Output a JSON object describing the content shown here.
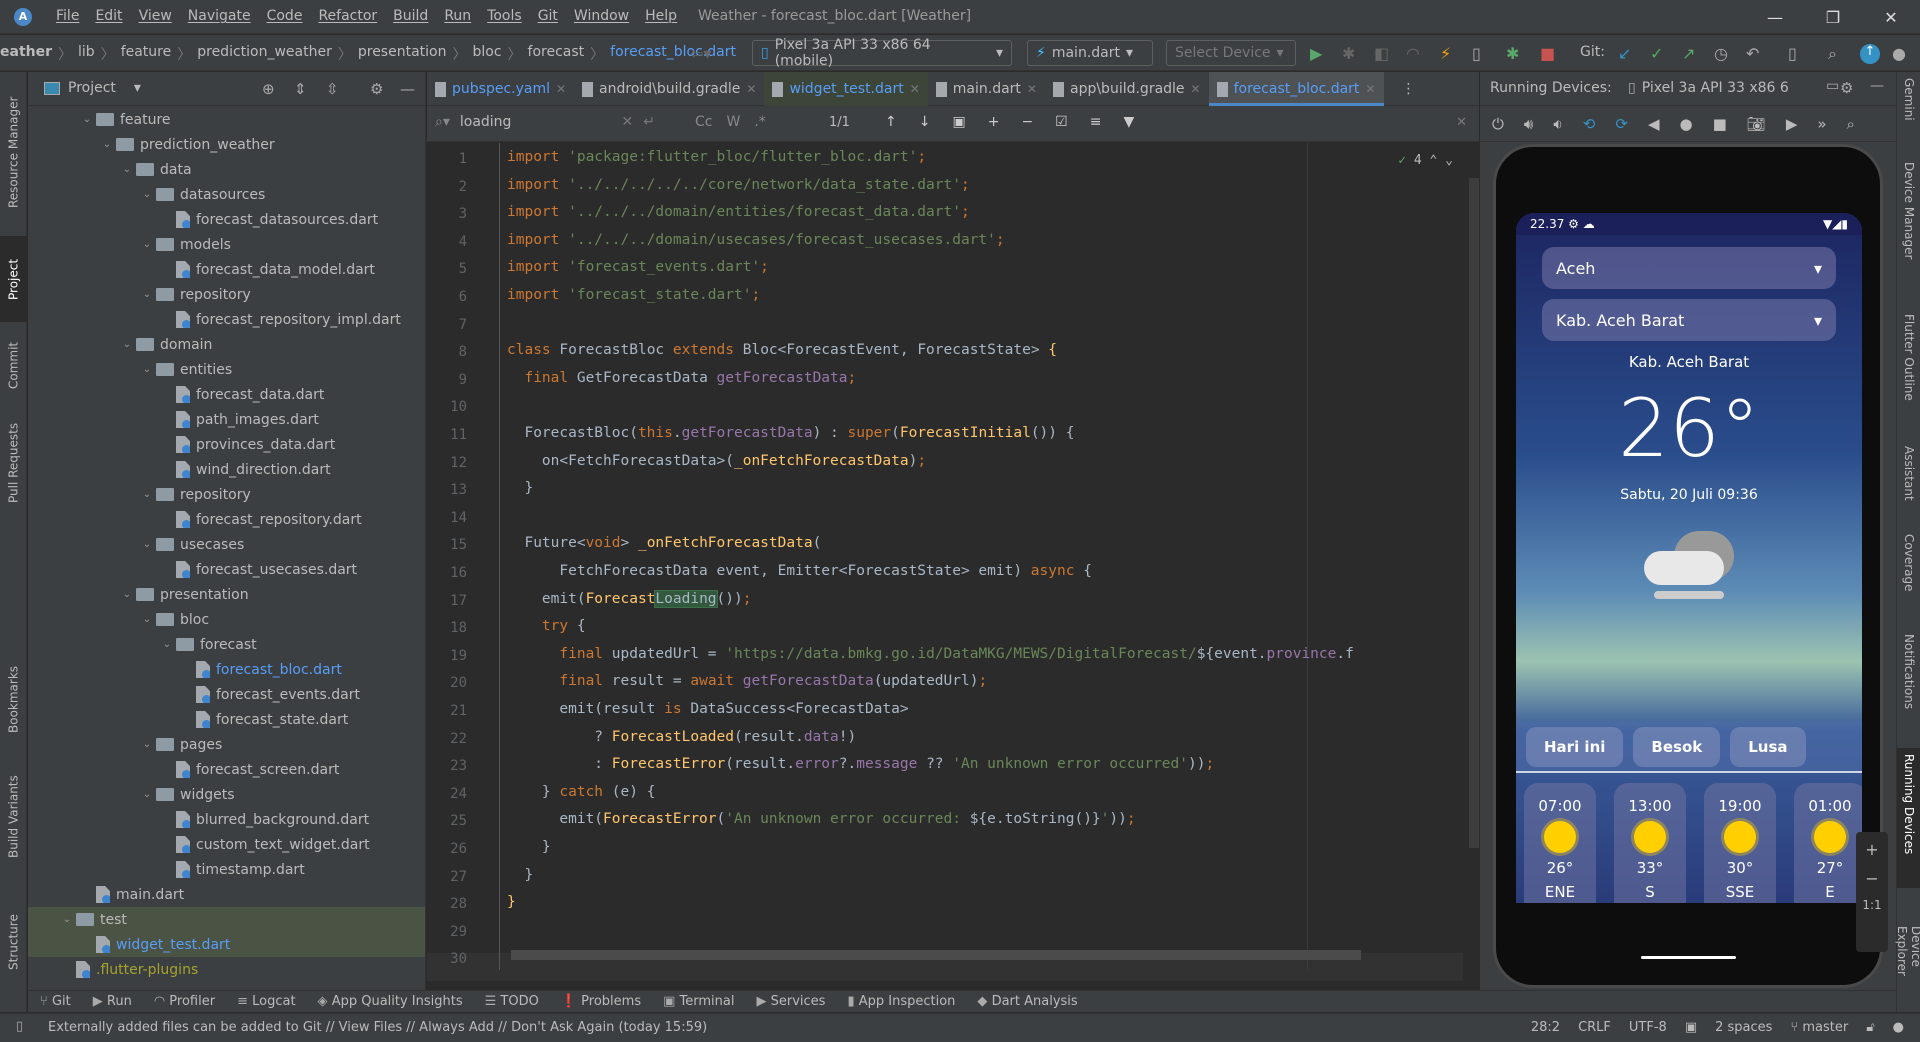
{
  "titlebar": {
    "menus": [
      "File",
      "Edit",
      "View",
      "Navigate",
      "Code",
      "Refactor",
      "Build",
      "Run",
      "Tools",
      "Git",
      "Window",
      "Help"
    ],
    "window_title": "Weather - forecast_bloc.dart [Weather]"
  },
  "navbar": {
    "breadcrumbs": [
      "eather",
      "lib",
      "feature",
      "prediction_weather",
      "presentation",
      "bloc",
      "forecast",
      "forecast_bloc.dart"
    ],
    "device_select": "Pixel 3a API 33 x86 64 (mobile)",
    "run_config": "main.dart",
    "select_device": "Select Device",
    "git_label": "Git:"
  },
  "left_strip": [
    "Resource Manager",
    "Project",
    "Commit",
    "Pull Requests",
    "Bookmarks",
    "Build Variants",
    "Structure"
  ],
  "right_strip": [
    "Gemini",
    "Device Manager",
    "Flutter Outline",
    "Assistant",
    "Coverage",
    "Notifications",
    "Running Devices",
    "Device Explorer"
  ],
  "project": {
    "title": "Project",
    "tree": [
      {
        "label": "feature",
        "type": "folder",
        "depth": 2
      },
      {
        "label": "prediction_weather",
        "type": "folder",
        "depth": 3
      },
      {
        "label": "data",
        "type": "folder",
        "depth": 4
      },
      {
        "label": "datasources",
        "type": "folder",
        "depth": 5
      },
      {
        "label": "forecast_datasources.dart",
        "type": "file",
        "depth": 6
      },
      {
        "label": "models",
        "type": "folder",
        "depth": 5
      },
      {
        "label": "forecast_data_model.dart",
        "type": "file",
        "depth": 6
      },
      {
        "label": "repository",
        "type": "folder",
        "depth": 5
      },
      {
        "label": "forecast_repository_impl.dart",
        "type": "file",
        "depth": 6
      },
      {
        "label": "domain",
        "type": "folder",
        "depth": 4
      },
      {
        "label": "entities",
        "type": "folder",
        "depth": 5
      },
      {
        "label": "forecast_data.dart",
        "type": "file",
        "depth": 6
      },
      {
        "label": "path_images.dart",
        "type": "file",
        "depth": 6
      },
      {
        "label": "provinces_data.dart",
        "type": "file",
        "depth": 6
      },
      {
        "label": "wind_direction.dart",
        "type": "file",
        "depth": 6
      },
      {
        "label": "repository",
        "type": "folder",
        "depth": 5
      },
      {
        "label": "forecast_repository.dart",
        "type": "file",
        "depth": 6
      },
      {
        "label": "usecases",
        "type": "folder",
        "depth": 5
      },
      {
        "label": "forecast_usecases.dart",
        "type": "file",
        "depth": 6
      },
      {
        "label": "presentation",
        "type": "folder",
        "depth": 4
      },
      {
        "label": "bloc",
        "type": "folder",
        "depth": 5
      },
      {
        "label": "forecast",
        "type": "folder",
        "depth": 6
      },
      {
        "label": "forecast_bloc.dart",
        "type": "file",
        "depth": 7,
        "style": "link"
      },
      {
        "label": "forecast_events.dart",
        "type": "file",
        "depth": 7
      },
      {
        "label": "forecast_state.dart",
        "type": "file",
        "depth": 7
      },
      {
        "label": "pages",
        "type": "folder",
        "depth": 5
      },
      {
        "label": "forecast_screen.dart",
        "type": "file",
        "depth": 6
      },
      {
        "label": "widgets",
        "type": "folder",
        "depth": 5
      },
      {
        "label": "blurred_background.dart",
        "type": "file",
        "depth": 6
      },
      {
        "label": "custom_text_widget.dart",
        "type": "file",
        "depth": 6
      },
      {
        "label": "timestamp.dart",
        "type": "file",
        "depth": 6
      },
      {
        "label": "main.dart",
        "type": "file",
        "depth": 2
      },
      {
        "label": "test",
        "type": "folder",
        "depth": 1,
        "style": "sel"
      },
      {
        "label": "widget_test.dart",
        "type": "file",
        "depth": 2,
        "style": "sel-link"
      },
      {
        "label": ".flutter-plugins",
        "type": "plain",
        "depth": 1,
        "style": "yel"
      }
    ]
  },
  "editor": {
    "tabs": [
      {
        "label": "pubspec.yaml",
        "style": "blue"
      },
      {
        "label": "android\\build.gradle",
        "style": ""
      },
      {
        "label": "widget_test.dart",
        "style": "green"
      },
      {
        "label": "main.dart",
        "style": ""
      },
      {
        "label": "app\\build.gradle",
        "style": ""
      },
      {
        "label": "forecast_bloc.dart",
        "style": "active"
      }
    ],
    "find": {
      "query": "loading",
      "match_count": "1/1",
      "options": [
        "Cc",
        "W",
        ".*"
      ]
    },
    "inspections": "4",
    "lines": [
      [
        [
          "kw",
          "import "
        ],
        [
          "str",
          "'package:flutter_bloc/flutter_bloc.dart'"
        ],
        [
          "kw",
          ";"
        ]
      ],
      [
        [
          "kw",
          "import "
        ],
        [
          "str",
          "'../../../../../core/network/data_state.dart'"
        ],
        [
          "kw",
          ";"
        ]
      ],
      [
        [
          "kw",
          "import "
        ],
        [
          "str",
          "'../../../domain/entities/forecast_data.dart'"
        ],
        [
          "kw",
          ";"
        ]
      ],
      [
        [
          "kw",
          "import "
        ],
        [
          "str",
          "'../../../domain/usecases/forecast_usecases.dart'"
        ],
        [
          "kw",
          ";"
        ]
      ],
      [
        [
          "kw",
          "import "
        ],
        [
          "str",
          "'forecast_events.dart'"
        ],
        [
          "kw",
          ";"
        ]
      ],
      [
        [
          "kw",
          "import "
        ],
        [
          "str",
          "'forecast_state.dart'"
        ],
        [
          "kw",
          ";"
        ]
      ],
      [],
      [
        [
          "kw",
          "class "
        ],
        [
          "typ",
          "ForecastBloc "
        ],
        [
          "kw",
          "extends "
        ],
        [
          "typ",
          "Bloc<ForecastEvent, ForecastState> "
        ],
        [
          "fn",
          "{"
        ]
      ],
      [
        [
          "typ",
          "  "
        ],
        [
          "kw",
          "final "
        ],
        [
          "typ",
          "GetForecastData "
        ],
        [
          "fld",
          "getForecastData"
        ],
        [
          "kw",
          ";"
        ]
      ],
      [],
      [
        [
          "typ",
          "  ForecastBloc("
        ],
        [
          "kw",
          "this"
        ],
        [
          "typ",
          "."
        ],
        [
          "fld",
          "getForecastData"
        ],
        [
          "typ",
          ") : "
        ],
        [
          "kw",
          "super"
        ],
        [
          "typ",
          "("
        ],
        [
          "fn",
          "ForecastInitial"
        ],
        [
          "typ",
          "()) {"
        ]
      ],
      [
        [
          "typ",
          "    on<FetchForecastData>("
        ],
        [
          "fn",
          "_onFetchForecastData"
        ],
        [
          "typ",
          ")"
        ],
        [
          "kw",
          ";"
        ]
      ],
      [
        [
          "typ",
          "  }"
        ]
      ],
      [],
      [
        [
          "typ",
          "  Future<"
        ],
        [
          "kw",
          "void"
        ],
        [
          "typ",
          "> "
        ],
        [
          "fn",
          "_onFetchForecastData"
        ],
        [
          "typ",
          "("
        ]
      ],
      [
        [
          "typ",
          "      FetchForecastData event, Emitter<ForecastState> emit) "
        ],
        [
          "kw",
          "async "
        ],
        [
          "typ",
          "{"
        ]
      ],
      [
        [
          "typ",
          "    emit("
        ],
        [
          "fn",
          "Forecast"
        ],
        [
          "hl",
          "Loading"
        ],
        [
          "typ",
          "())"
        ],
        [
          "kw",
          ";"
        ]
      ],
      [
        [
          "typ",
          "    "
        ],
        [
          "kw",
          "try "
        ],
        [
          "typ",
          "{"
        ]
      ],
      [
        [
          "typ",
          "      "
        ],
        [
          "kw",
          "final "
        ],
        [
          "typ",
          "updatedUrl = "
        ],
        [
          "str",
          "'https://data.bmkg.go.id/DataMKG/MEWS/DigitalForecast/"
        ],
        [
          "typ",
          "${event."
        ],
        [
          "fld",
          "province"
        ],
        [
          "typ",
          ".f"
        ]
      ],
      [
        [
          "typ",
          "      "
        ],
        [
          "kw",
          "final "
        ],
        [
          "typ",
          "result = "
        ],
        [
          "kw",
          "await "
        ],
        [
          "fld",
          "getForecastData"
        ],
        [
          "typ",
          "(updatedUrl)"
        ],
        [
          "kw",
          ";"
        ]
      ],
      [
        [
          "typ",
          "      emit(result "
        ],
        [
          "kw",
          "is "
        ],
        [
          "typ",
          "DataSuccess<ForecastData>"
        ]
      ],
      [
        [
          "typ",
          "          ? "
        ],
        [
          "fn",
          "ForecastLoaded"
        ],
        [
          "typ",
          "(result."
        ],
        [
          "fld",
          "data"
        ],
        [
          "typ",
          "!)"
        ]
      ],
      [
        [
          "typ",
          "          : "
        ],
        [
          "fn",
          "ForecastError"
        ],
        [
          "typ",
          "(result."
        ],
        [
          "fld",
          "error"
        ],
        [
          "typ",
          "?."
        ],
        [
          "fld",
          "message"
        ],
        [
          "typ",
          " ?? "
        ],
        [
          "str",
          "'An unknown error occurred'"
        ],
        [
          "typ",
          "))"
        ],
        [
          "kw",
          ";"
        ]
      ],
      [
        [
          "typ",
          "    } "
        ],
        [
          "kw",
          "catch "
        ],
        [
          "typ",
          "(e) {"
        ]
      ],
      [
        [
          "typ",
          "      emit("
        ],
        [
          "fn",
          "ForecastError"
        ],
        [
          "typ",
          "("
        ],
        [
          "str",
          "'An unknown error occurred: "
        ],
        [
          "typ",
          "${e.toString()}"
        ],
        [
          "str",
          "'"
        ],
        [
          "typ",
          "))"
        ],
        [
          "kw",
          ";"
        ]
      ],
      [
        [
          "typ",
          "    }"
        ]
      ],
      [
        [
          "typ",
          "  }"
        ]
      ],
      [
        [
          "fn",
          "}"
        ]
      ],
      [],
      []
    ]
  },
  "running_devices": {
    "label": "Running Devices:",
    "device_tab": "Pixel 3a API 33 x86 6"
  },
  "phone": {
    "status_time": "22.37",
    "province": "Aceh",
    "regency": "Kab. Aceh Barat",
    "city": "Kab. Aceh Barat",
    "temperature": "26°",
    "datetime": "Sabtu, 20 Juli 09:36",
    "day_tabs": [
      "Hari ini",
      "Besok",
      "Lusa"
    ],
    "hourly": [
      {
        "time": "07:00",
        "temp": "26°",
        "wind": "ENE"
      },
      {
        "time": "13:00",
        "temp": "33°",
        "wind": "S"
      },
      {
        "time": "19:00",
        "temp": "30°",
        "wind": "SSE"
      },
      {
        "time": "01:00",
        "temp": "27°",
        "wind": "E"
      }
    ],
    "zoom_controls": [
      "+",
      "−",
      "1:1"
    ]
  },
  "tool_windows": [
    "Git",
    "Run",
    "Profiler",
    "Logcat",
    "App Quality Insights",
    "TODO",
    "Problems",
    "Terminal",
    "Services",
    "App Inspection",
    "Dart Analysis"
  ],
  "status": {
    "message": "Externally added files can be added to Git // View Files // Always Add // Don't Ask Again (today 15:59)",
    "position": "28:2",
    "line_sep": "CRLF",
    "encoding": "UTF-8",
    "indent": "2 spaces",
    "branch": "master"
  }
}
